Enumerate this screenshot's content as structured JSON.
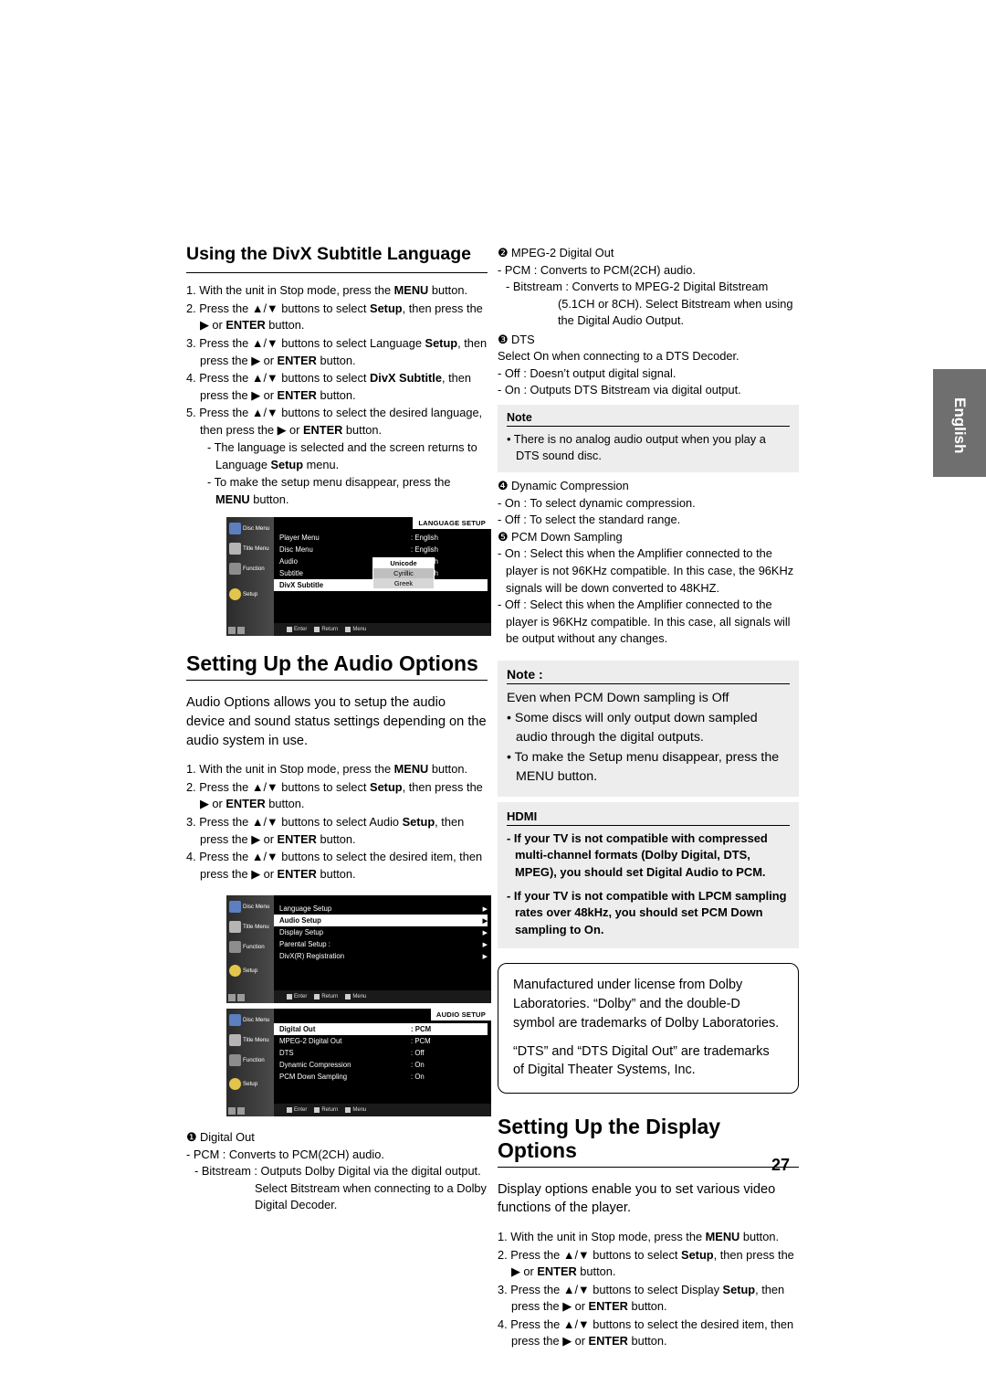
{
  "page": {
    "number": "27",
    "side_tab": "English"
  },
  "left_column": {
    "divx_heading": "Using the DivX Subtitle Language",
    "divx_steps": [
      "1. With the unit in Stop mode, press the MENU button.",
      "2. Press the ▲/▼ buttons to select Setup, then press the ▶ or ENTER button.",
      "3. Press the ▲/▼ buttons to select Language Setup, then press the ▶ or ENTER button.",
      "4. Press the ▲/▼ buttons to select DivX Subtitle, then press the ▶ or ENTER button.",
      "5. Press the ▲/▼ buttons to select the desired  language, then press the ▶ or ENTER button.",
      "- The language is selected and the screen returns to Language Setup menu.",
      "- To make the setup menu disappear, press the MENU button."
    ],
    "language_osd": {
      "title": "LANGUAGE SETUP",
      "side_labels": [
        "Disc Menu",
        "Title Menu",
        "Function",
        "Setup"
      ],
      "rows": [
        {
          "key": "Player Menu",
          "value": ": English"
        },
        {
          "key": "Disc Menu",
          "value": ": English"
        },
        {
          "key": "Audio",
          "value": ": English"
        },
        {
          "key": "Subtitle",
          "value": ": English"
        },
        {
          "key": "DivX Subtitle",
          "value": ""
        }
      ],
      "popup": [
        "Unicode",
        "Cyrillic",
        "Greek"
      ],
      "bottom": [
        "Enter",
        "Return",
        "Menu"
      ]
    },
    "audio_title": "Setting Up the Audio Options",
    "audio_intro": "Audio Options allows you to setup the audio device and sound status settings depending on the audio system in use.",
    "audio_steps": [
      "1. With the unit in Stop mode, press the MENU button.",
      "2. Press the ▲/▼ buttons to select Setup, then press the ▶ or ENTER button.",
      "3. Press the ▲/▼ buttons to select Audio Setup, then press the ▶ or ENTER button.",
      "4. Press the ▲/▼ buttons to select the desired item, then press the ▶ or ENTER button."
    ],
    "setup_osd": {
      "title": "",
      "rows": [
        {
          "key": "Language Setup",
          "value": "▶"
        },
        {
          "key": "Audio Setup",
          "value": "▶"
        },
        {
          "key": "Display Setup",
          "value": "▶"
        },
        {
          "key": "Parental Setup :",
          "value": "▶"
        },
        {
          "key": "DivX(R) Registration",
          "value": "▶"
        }
      ],
      "bottom": [
        "Enter",
        "Return",
        "Menu"
      ]
    },
    "audio_osd": {
      "title": "AUDIO SETUP",
      "rows": [
        {
          "key": "Digital Out",
          "value": ": PCM"
        },
        {
          "key": "MPEG-2 Digital Out",
          "value": ": PCM"
        },
        {
          "key": "DTS",
          "value": ": Off"
        },
        {
          "key": "Dynamic Compression",
          "value": ": On"
        },
        {
          "key": "PCM Down Sampling",
          "value": ": On"
        }
      ],
      "bottom": [
        "Enter",
        "Return",
        "Menu"
      ]
    },
    "digital_out_notes": [
      "❶ Digital Out",
      "- PCM : Converts to PCM(2CH) audio.",
      "- Bitstream : Outputs Dolby Digital via the digital output. Select Bitstream when connecting to a Dolby Digital Decoder."
    ]
  },
  "right_column": {
    "mpeg_items": [
      "❷ MPEG-2 Digital Out",
      "- PCM : Converts to PCM(2CH) audio.",
      "- Bitstream : Converts to MPEG-2 Digital Bitstream (5.1CH or 8CH). Select Bitstream when using the Digital Audio Output."
    ],
    "dts_items": [
      "❸ DTS",
      "Select On when connecting to a DTS Decoder.",
      "- Off : Doesn’t output digital signal.",
      "- On : Outputs DTS Bitstream via digital output."
    ],
    "note1": {
      "label": "Note",
      "text": "• There is no analog audio output when you play a DTS sound disc."
    },
    "dynamic_items": [
      "❹ Dynamic Compression",
      "- On : To select dynamic compression.",
      "- Off : To select the standard range."
    ],
    "pcm_items": [
      "❺ PCM Down Sampling",
      "- On : Select this when the Amplifier connected to the player is not 96KHz compatible. In this case, the 96KHz signals will be down converted to 48KHZ.",
      "- Off : Select this when the Amplifier connected to the player is 96KHz compatible. In this case, all signals will be output without any changes."
    ],
    "note2": {
      "label": "Note :",
      "line1": "Even when PCM Down sampling is Off",
      "line2": "• Some discs will only output down sampled audio through the digital outputs.",
      "line3": "• To make the Setup menu disappear, press the MENU button."
    },
    "hdmi": {
      "label": "HDMI",
      "p1": "- If your TV is not compatible with compressed multi-channel formats (Dolby Digital, DTS, MPEG), you should set Digital Audio to PCM.",
      "p2": "- If your TV is not compatible with LPCM sampling rates over 48kHz, you should set PCM Down sampling to On."
    },
    "trademark": {
      "p1": "Manufactured under license from Dolby Laboratories. “Dolby” and the double-D symbol are trademarks of Dolby Laboratories.",
      "p2": "“DTS” and “DTS Digital Out” are trademarks of Digital Theater Systems, Inc."
    },
    "display_title": "Setting Up the Display Options",
    "display_intro": "Display options enable you to set various video functions of the player.",
    "display_steps": [
      "1. With the unit in Stop mode, press the MENU button.",
      "2. Press the ▲/▼ buttons to select Setup, then press the ▶ or ENTER button.",
      "3. Press the ▲/▼ buttons to select Display Setup, then press the ▶ or ENTER button.",
      "4. Press the ▲/▼ buttons to select the desired item, then press the ▶ or ENTER button."
    ]
  }
}
